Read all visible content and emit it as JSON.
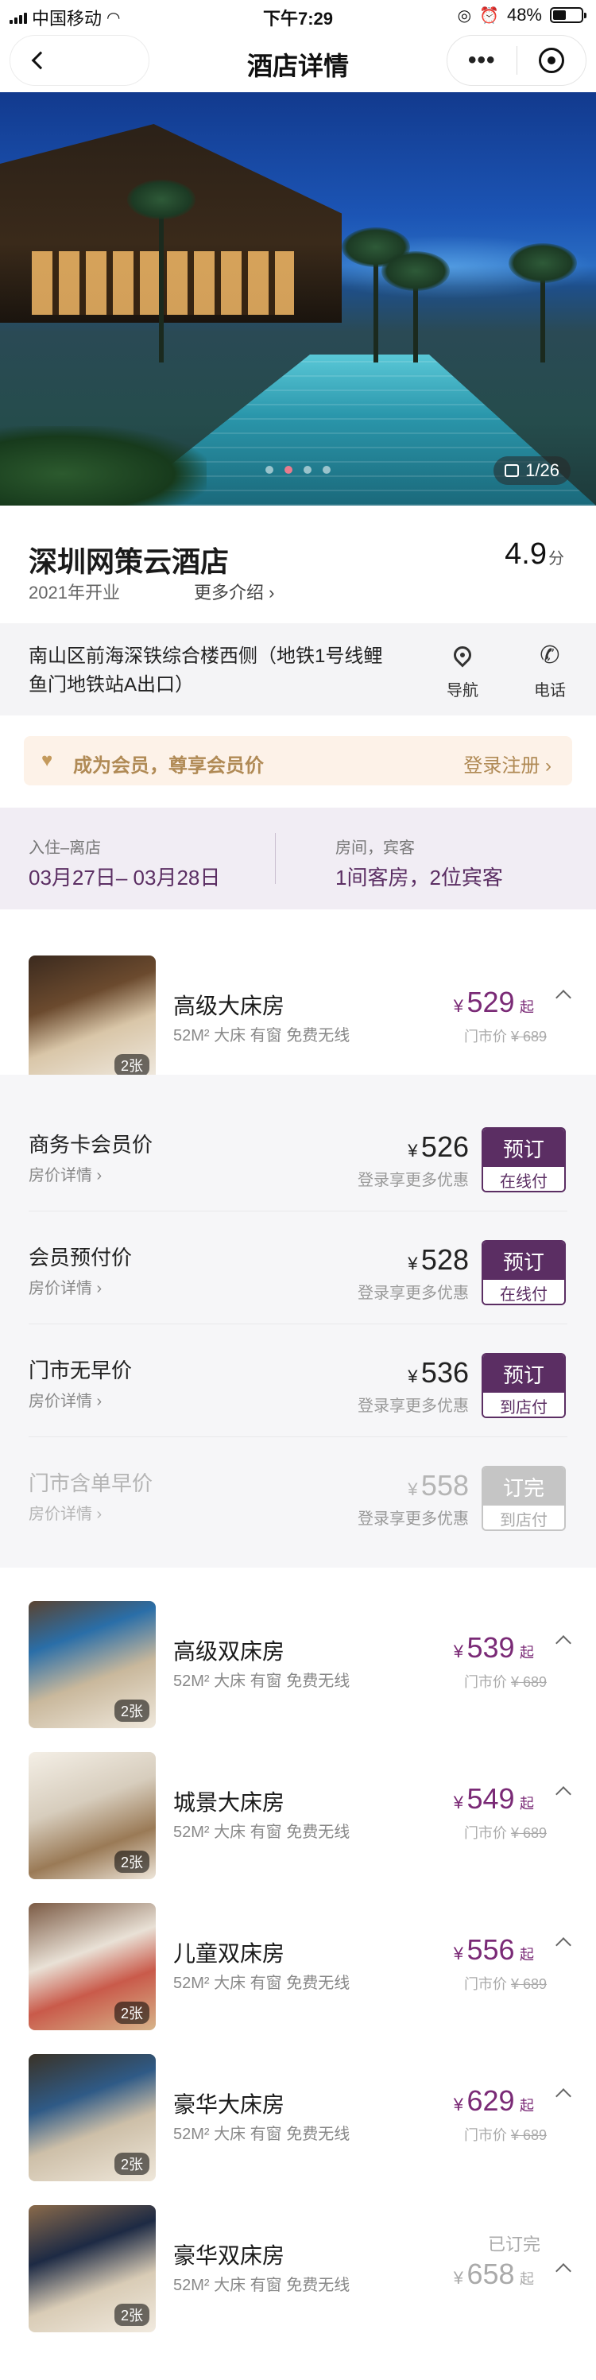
{
  "status_bar": {
    "carrier": "中国移动",
    "time": "下午7:29",
    "battery_percent": "48%",
    "battery_level": 0.48
  },
  "nav": {
    "back_icon": "chevron-left-icon",
    "title": "酒店详情",
    "more_icon": "more-dots-icon",
    "target_icon": "target-icon"
  },
  "hero": {
    "photo_counter": "1/26",
    "slide_count": 4,
    "active_slide": 2
  },
  "hotel": {
    "name": "深圳网策云酒店",
    "opened": "2021年开业",
    "more_intro": "更多介绍 ›",
    "score": "4.9",
    "score_unit": "分"
  },
  "address": {
    "text": "南山区前海深铁综合楼西侧（地铁1号线鲤鱼门地铁站A出口）",
    "nav_label": "导航",
    "phone_label": "电话"
  },
  "member_banner": {
    "text": "成为会员，尊享会员价",
    "login": "登录注册 ›"
  },
  "stay": {
    "checkin_label": "入住–离店",
    "checkin_value": "03月27日– 03月28日",
    "rooms_label": "房间，宾客",
    "rooms_value": "1间客房，2位宾客"
  },
  "rooms": [
    {
      "name": "高级大床房",
      "spec": "52M² 大床 有窗 免费无线",
      "price": "529",
      "currency": "¥",
      "from": "起",
      "market_label": "门市价",
      "market_price": "¥ 689",
      "pics": "2张"
    },
    {
      "name": "高级双床房",
      "spec": "52M² 大床 有窗 免费无线",
      "price": "539",
      "currency": "¥",
      "from": "起",
      "market_label": "门市价",
      "market_price": "¥ 689",
      "pics": "2张"
    },
    {
      "name": "城景大床房",
      "spec": "52M² 大床 有窗 免费无线",
      "price": "549",
      "currency": "¥",
      "from": "起",
      "market_label": "门市价",
      "market_price": "¥ 689",
      "pics": "2张"
    },
    {
      "name": "儿童双床房",
      "spec": "52M² 大床 有窗 免费无线",
      "price": "556",
      "currency": "¥",
      "from": "起",
      "market_label": "门市价",
      "market_price": "¥ 689",
      "pics": "2张"
    },
    {
      "name": "豪华大床房",
      "spec": "52M² 大床 有窗 免费无线",
      "price": "629",
      "currency": "¥",
      "from": "起",
      "market_label": "门市价",
      "market_price": "¥ 689",
      "pics": "2张"
    },
    {
      "name": "豪华双床房",
      "spec": "52M² 大床 有窗 免费无线",
      "price": "658",
      "currency": "¥",
      "from": "起",
      "status": "已订完",
      "pics": "2张"
    }
  ],
  "rates": [
    {
      "title": "商务卡会员价",
      "link": "房价详情 ›",
      "currency": "¥",
      "price": "526",
      "hint": "登录享更多优惠",
      "btn_top": "预订",
      "btn_bottom": "在线付"
    },
    {
      "title": "会员预付价",
      "link": "房价详情 ›",
      "currency": "¥",
      "price": "528",
      "hint": "登录享更多优惠",
      "btn_top": "预订",
      "btn_bottom": "在线付"
    },
    {
      "title": "门市无早价",
      "link": "房价详情 ›",
      "currency": "¥",
      "price": "536",
      "hint": "登录享更多优惠",
      "btn_top": "预订",
      "btn_bottom": "到店付"
    },
    {
      "title": "门市含单早价",
      "link": "房价详情 ›",
      "currency": "¥",
      "price": "558",
      "hint": "登录享更多优惠",
      "btn_top": "订完",
      "btn_bottom": "到店付"
    }
  ],
  "colors": {
    "brand": "#5b2e63",
    "price": "#7a2a76",
    "member_gold": "#b08a55"
  }
}
